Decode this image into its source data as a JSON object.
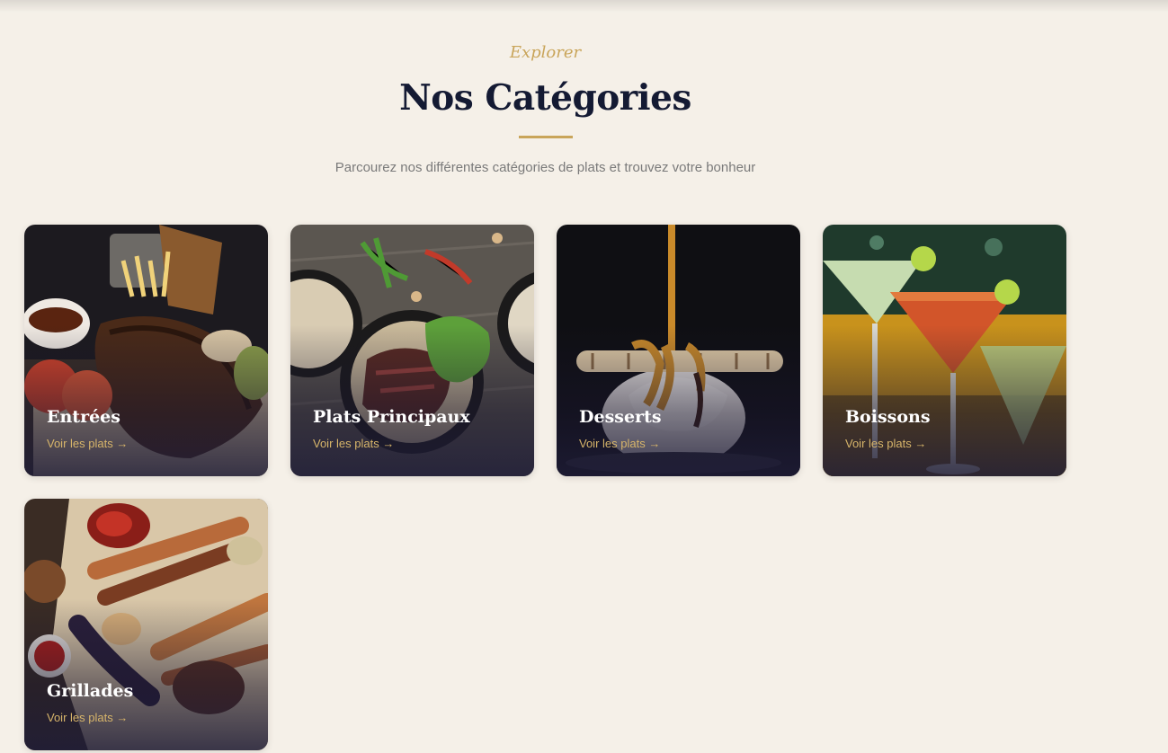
{
  "header": {
    "eyebrow": "Explorer",
    "title": "Nos Catégories",
    "subtitle": "Parcourez nos différentes catégories de plats et trouvez votre bonheur"
  },
  "colors": {
    "background": "#f5f0e8",
    "accent": "#c9a55a",
    "title": "#141a33"
  },
  "categories": [
    {
      "name": "Entrées",
      "link": "Voir les plats →",
      "image": "ribs-platter-image"
    },
    {
      "name": "Plats Principaux",
      "link": "Voir les plats →",
      "image": "steak-bowl-image"
    },
    {
      "name": "Desserts",
      "link": "Voir les plats →",
      "image": "ice-cream-caramel-image"
    },
    {
      "name": "Boissons",
      "link": "Voir les plats →",
      "image": "cocktails-image"
    },
    {
      "name": "Grillades",
      "link": "Voir les plats →",
      "image": "grilled-skewers-image"
    }
  ]
}
